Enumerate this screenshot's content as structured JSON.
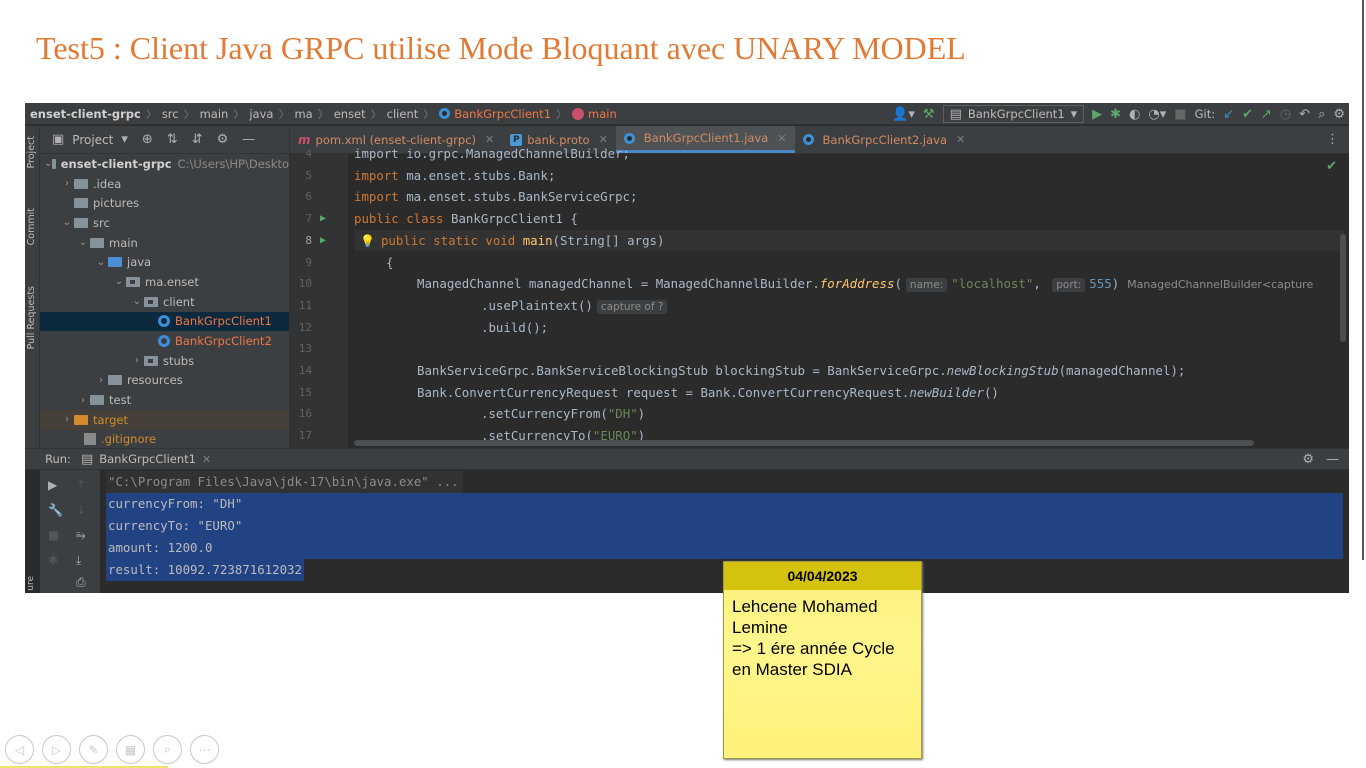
{
  "slide": {
    "title": "Test5 : Client Java GRPC utilise Mode Bloquant avec UNARY MODEL"
  },
  "ide": {
    "breadcrumbs": [
      "enset-client-grpc",
      "src",
      "main",
      "java",
      "ma",
      "enset",
      "client",
      "BankGrpcClient1",
      "main"
    ],
    "run_config": "BankGrpcClient1",
    "git_label": "Git:",
    "side_labels": {
      "project": "Project",
      "commit": "Commit",
      "pull_requests": "Pull Requests",
      "structure": "ure"
    },
    "project_panel": {
      "header": "Project",
      "tree": [
        {
          "label": "enset-client-grpc",
          "hint": "C:\\Users\\HP\\Deskto"
        },
        {
          "label": ".idea"
        },
        {
          "label": "pictures"
        },
        {
          "label": "src"
        },
        {
          "label": "main"
        },
        {
          "label": "java"
        },
        {
          "label": "ma.enset"
        },
        {
          "label": "client"
        },
        {
          "label": "BankGrpcClient1"
        },
        {
          "label": "BankGrpcClient2"
        },
        {
          "label": "stubs"
        },
        {
          "label": "resources"
        },
        {
          "label": "test"
        },
        {
          "label": "target"
        },
        {
          "label": ".gitignore"
        }
      ]
    },
    "tabs": [
      {
        "label": "pom.xml (enset-client-grpc)"
      },
      {
        "label": "bank.proto"
      },
      {
        "label": "BankGrpcClient1.java"
      },
      {
        "label": "BankGrpcClient2.java"
      }
    ],
    "line_numbers": [
      "4",
      "5",
      "6",
      "7",
      "8",
      "9",
      "10",
      "11",
      "12",
      "13",
      "14",
      "15",
      "16",
      "17"
    ],
    "code": {
      "l4": "import io.grpc.ManagedChannelBuilder;",
      "l5_kw": "import",
      "l5_rest": " ma.enset.stubs.Bank;",
      "l6_kw": "import",
      "l6_rest": " ma.enset.stubs.BankServiceGrpc;",
      "l7_kw": "public class",
      "l7_rest": " BankGrpcClient1 {",
      "l8_kw": "public static void",
      "l8_fn": "main",
      "l8_rest": "(String[] args)",
      "l9": "{",
      "l10_a": "ManagedChannel managedChannel = ManagedChannelBuilder.",
      "l10_fn": "forAddress",
      "l10_b": "(",
      "l10_hint1": "name:",
      "l10_str": "\"localhost\"",
      "l10_c": ", ",
      "l10_hint2": "port:",
      "l10_num": "555",
      "l10_d": ")",
      "l10_hint3": "ManagedChannelBuilder<capture",
      "l11": ".usePlaintext()",
      "l11_hint": "capture of ?",
      "l12": ".build();",
      "l14_a": "BankServiceGrpc.BankServiceBlockingStub blockingStub = BankServiceGrpc.",
      "l14_fn": "newBlockingStub",
      "l14_b": "(managedChannel);",
      "l15_a": "Bank.ConvertCurrencyRequest request = Bank.ConvertCurrencyRequest.",
      "l15_fn": "newBuilder",
      "l15_b": "()",
      "l16_a": ".setCurrencyFrom(",
      "l16_str": "\"DH\"",
      "l16_b": ")",
      "l17_a": ".setCurrencyTo(",
      "l17_str": "\"EURO\"",
      "l17_b": ")"
    },
    "run": {
      "label": "Run:",
      "tab": "BankGrpcClient1",
      "console": [
        "\"C:\\Program Files\\Java\\jdk-17\\bin\\java.exe\" ...",
        "currencyFrom: \"DH\"",
        "currencyTo: \"EURO\"",
        "amount: 1200.0",
        "result: 10092.723871612032"
      ]
    }
  },
  "note": {
    "date": "04/04/2023",
    "lines": [
      "Lehcene Mohamed",
      "Lemine",
      "=> 1 ére année Cycle",
      "en Master SDIA"
    ]
  },
  "colors": {
    "title": "#e07a35",
    "ide_bg": "#2b2b2b",
    "selection": "#214283",
    "note_bg": "#fff68c",
    "note_header": "#d5c20f"
  },
  "icons": {
    "nav": [
      "prev-slide-icon",
      "next-slide-icon",
      "pen-icon",
      "slides-grid-icon",
      "zoom-icon",
      "more-icon"
    ]
  }
}
